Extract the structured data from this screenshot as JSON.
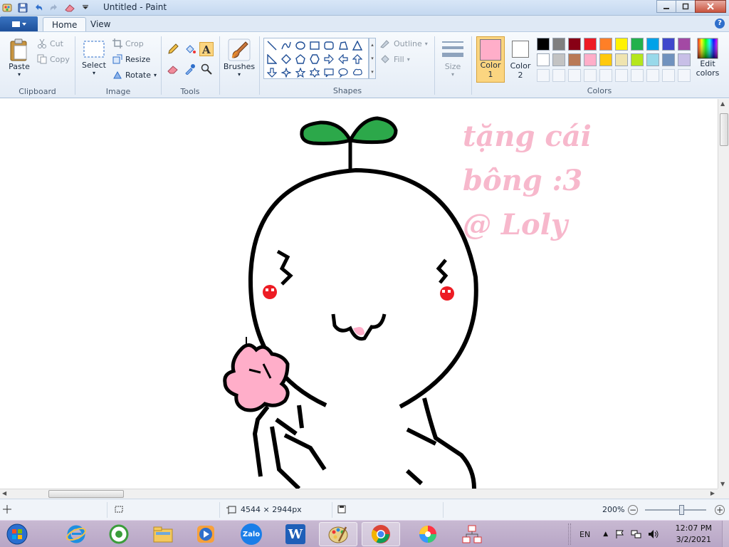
{
  "window": {
    "title": "Untitled - Paint"
  },
  "tabs": [
    {
      "label": "Home"
    },
    {
      "label": "View"
    }
  ],
  "ribbon": {
    "clipboard": {
      "group_label": "Clipboard",
      "paste": "Paste",
      "cut": "Cut",
      "copy": "Copy"
    },
    "image": {
      "group_label": "Image",
      "select": "Select",
      "crop": "Crop",
      "resize": "Resize",
      "rotate": "Rotate"
    },
    "tools": {
      "group_label": "Tools"
    },
    "brushes": {
      "label": "Brushes"
    },
    "shapes": {
      "group_label": "Shapes",
      "outline": "Outline",
      "fill": "Fill"
    },
    "size": {
      "label": "Size"
    },
    "colors": {
      "group_label": "Colors",
      "color1_label": "Color",
      "color1_num": "1",
      "color2_label": "Color",
      "color2_num": "2",
      "color1": "#ffaec9",
      "color2": "#ffffff",
      "edit_label": "Edit",
      "edit_label2": "colors",
      "palette_row1": [
        "#000000",
        "#7f7f7f",
        "#880015",
        "#ed1c24",
        "#ff7f27",
        "#fff200",
        "#22b14c",
        "#00a2e8",
        "#3f48cc",
        "#a349a4"
      ],
      "palette_row2": [
        "#ffffff",
        "#c3c3c3",
        "#b97a57",
        "#ffaec9",
        "#ffc90e",
        "#efe4b0",
        "#b5e61d",
        "#99d9ea",
        "#7092be",
        "#c8bfe7"
      ]
    }
  },
  "canvas": {
    "text_line1": "tặng cái",
    "text_line2": "bông :3",
    "text_line3": "@ Loly",
    "text_color": "#f7b8cc",
    "drawing": "cartoon round character with a green sprout, red cheeks and a pink flower"
  },
  "status": {
    "image_size": "4544 × 2944px",
    "zoom": "200%",
    "zoom_fraction": 0.6
  },
  "taskbar": {
    "apps": [
      "start-orb",
      "internet-explorer",
      "coccoc",
      "file-explorer",
      "media-player",
      "zalo",
      "word",
      "paint",
      "chrome",
      "color-app",
      "network-app"
    ],
    "zalo_label": "Zalo",
    "word_label": "W",
    "lang": "EN",
    "time": "12:07 PM",
    "date": "3/2/2021"
  }
}
